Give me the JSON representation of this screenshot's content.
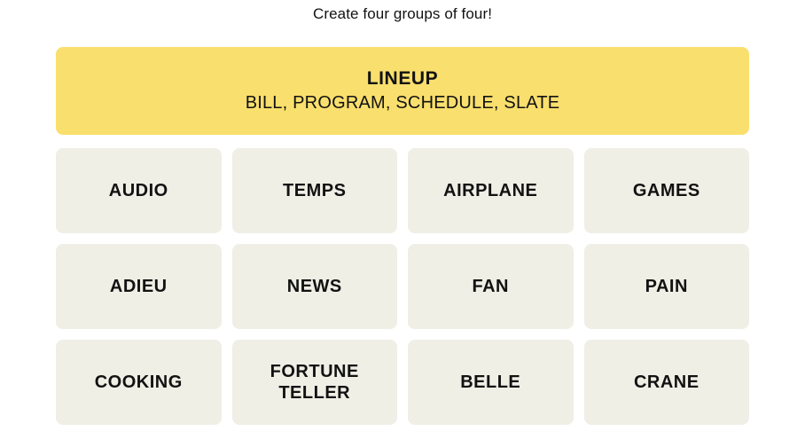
{
  "header": {
    "instruction": "Create four groups of four!"
  },
  "colors": {
    "yellow_group": "#f9df6d",
    "tile_background": "#efefe6",
    "page_background": "#ffffff",
    "text": "#121212"
  },
  "solved_groups": [
    {
      "title": "LINEUP",
      "members_text": "BILL, PROGRAM, SCHEDULE, SLATE",
      "members": [
        "BILL",
        "PROGRAM",
        "SCHEDULE",
        "SLATE"
      ],
      "color": "#f9df6d",
      "difficulty": "yellow"
    }
  ],
  "tiles": [
    {
      "label": "AUDIO"
    },
    {
      "label": "TEMPS"
    },
    {
      "label": "AIRPLANE"
    },
    {
      "label": "GAMES"
    },
    {
      "label": "ADIEU"
    },
    {
      "label": "NEWS"
    },
    {
      "label": "FAN"
    },
    {
      "label": "PAIN"
    },
    {
      "label": "COOKING"
    },
    {
      "label": "FORTUNE\nTELLER"
    },
    {
      "label": "BELLE"
    },
    {
      "label": "CRANE"
    }
  ]
}
